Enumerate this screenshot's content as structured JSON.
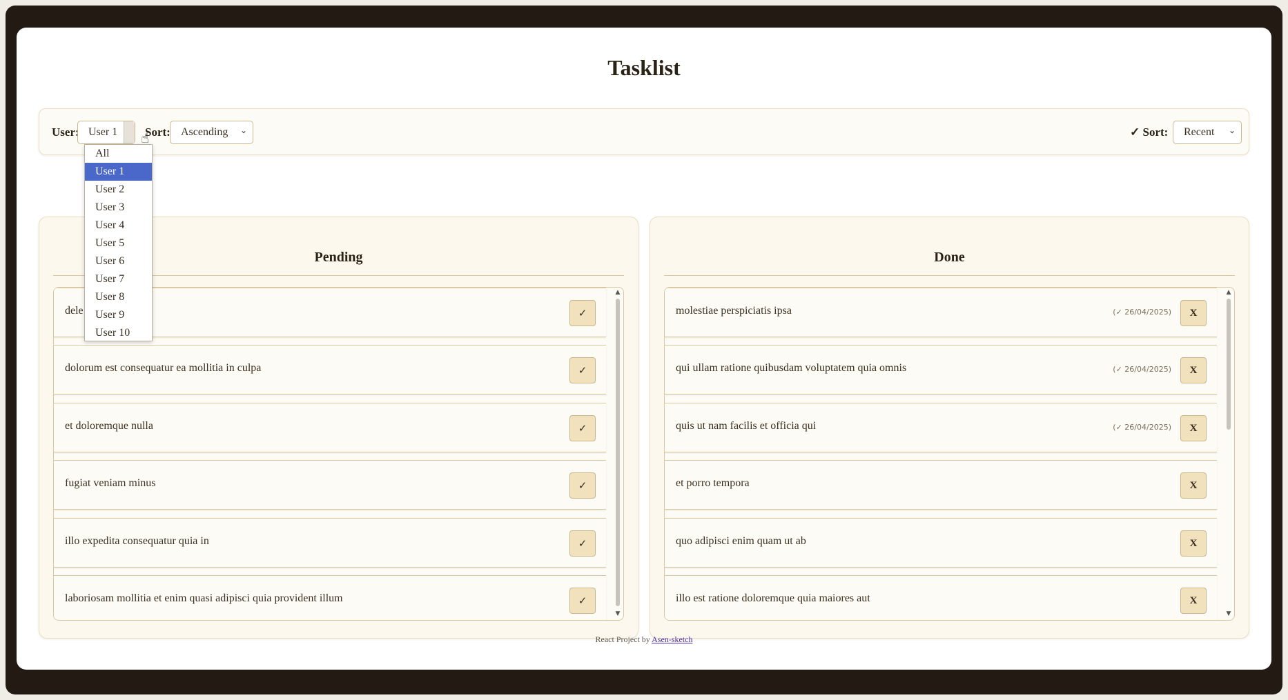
{
  "app": {
    "title": "Tasklist"
  },
  "toolbar": {
    "user_label": "User:",
    "user_value": "User 1",
    "sort_label": "Sort:",
    "sort_value": "Ascending",
    "done_sort_label": "✓ Sort:",
    "done_sort_value": "Recent"
  },
  "user_dropdown": {
    "selected": "User 1",
    "options": [
      "All",
      "User 1",
      "User 2",
      "User 3",
      "User 4",
      "User 5",
      "User 6",
      "User 7",
      "User 8",
      "User 9",
      "User 10"
    ]
  },
  "pending": {
    "title": "Pending",
    "button_label": "✓",
    "tasks": [
      "dele",
      "dolorum est consequatur ea mollitia in culpa",
      "et doloremque nulla",
      "fugiat veniam minus",
      "illo expedita consequatur quia in",
      "laboriosam mollitia et enim quasi adipisci quia provident illum"
    ]
  },
  "done": {
    "title": "Done",
    "button_label": "X",
    "tasks": [
      {
        "text": "molestiae perspiciatis ipsa",
        "date": "(✓ 26/04/2025)"
      },
      {
        "text": "qui ullam ratione quibusdam voluptatem quia omnis",
        "date": "(✓ 26/04/2025)"
      },
      {
        "text": "quis ut nam facilis et officia qui",
        "date": "(✓ 26/04/2025)"
      },
      {
        "text": "et porro tempora",
        "date": ""
      },
      {
        "text": "quo adipisci enim quam ut ab",
        "date": ""
      },
      {
        "text": "illo est ratione doloremque quia maiores aut",
        "date": ""
      }
    ]
  },
  "footer": {
    "prefix": "React Project by",
    "link": "Asen-sketch"
  },
  "colors": {
    "frame": "#231b13",
    "accent": "#4a68c9",
    "button": "#f1e1bd",
    "panel": "#fcf8ee"
  }
}
